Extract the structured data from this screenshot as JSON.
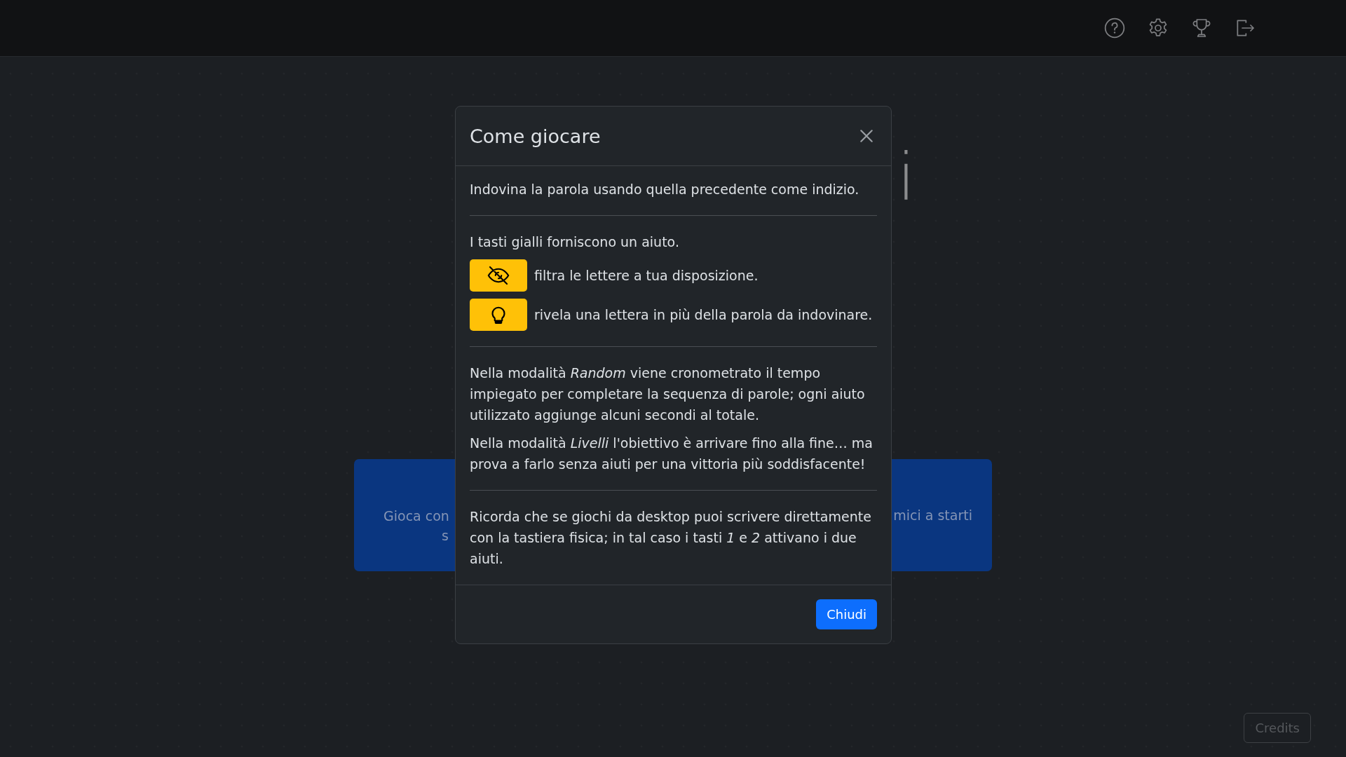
{
  "background": {
    "title_fragments": [
      "i"
    ],
    "cards": [
      {
        "lines": [
          "Gioca con",
          "s"
        ]
      },
      {
        "lines": [
          "mici a starti"
        ]
      }
    ],
    "credits_button": "Credits"
  },
  "modal": {
    "title": "Come giocare",
    "sections": [
      {
        "blocks": [
          {
            "kind": "paragraph",
            "text": "Indovina la parola usando quella precedente come indizio."
          }
        ]
      },
      {
        "blocks": [
          {
            "kind": "paragraph",
            "text": "I tasti gialli forniscono un aiuto."
          },
          {
            "kind": "filter",
            "text": "filtra le lettere a tua disposizione."
          },
          {
            "kind": "reveal",
            "text": "rivela una lettera in più della parola da indovinare."
          }
        ]
      },
      {
        "blocks": [
          {
            "kind": "paragraph",
            "text": "Nella modalità *Random* viene cronometrato il tempo impiegato per completare la sequenza di parole; ogni aiuto utilizzato aggiunge alcuni secondi al totale."
          },
          {
            "kind": "paragraph",
            "text": "Nella modalità *Livelli* l'obiettivo è arrivare fino alla fine… ma prova a farlo senza aiuti per una vittoria più soddisfacente!"
          }
        ]
      },
      {
        "blocks": [
          {
            "kind": "paragraph",
            "text": "Ricorda che se giochi da desktop puoi scrivere direttamente con la tastiera fisica; in tal caso i tasti *1* e *2* attivano i due aiuti."
          }
        ]
      }
    ],
    "close_button": "Chiudi"
  }
}
